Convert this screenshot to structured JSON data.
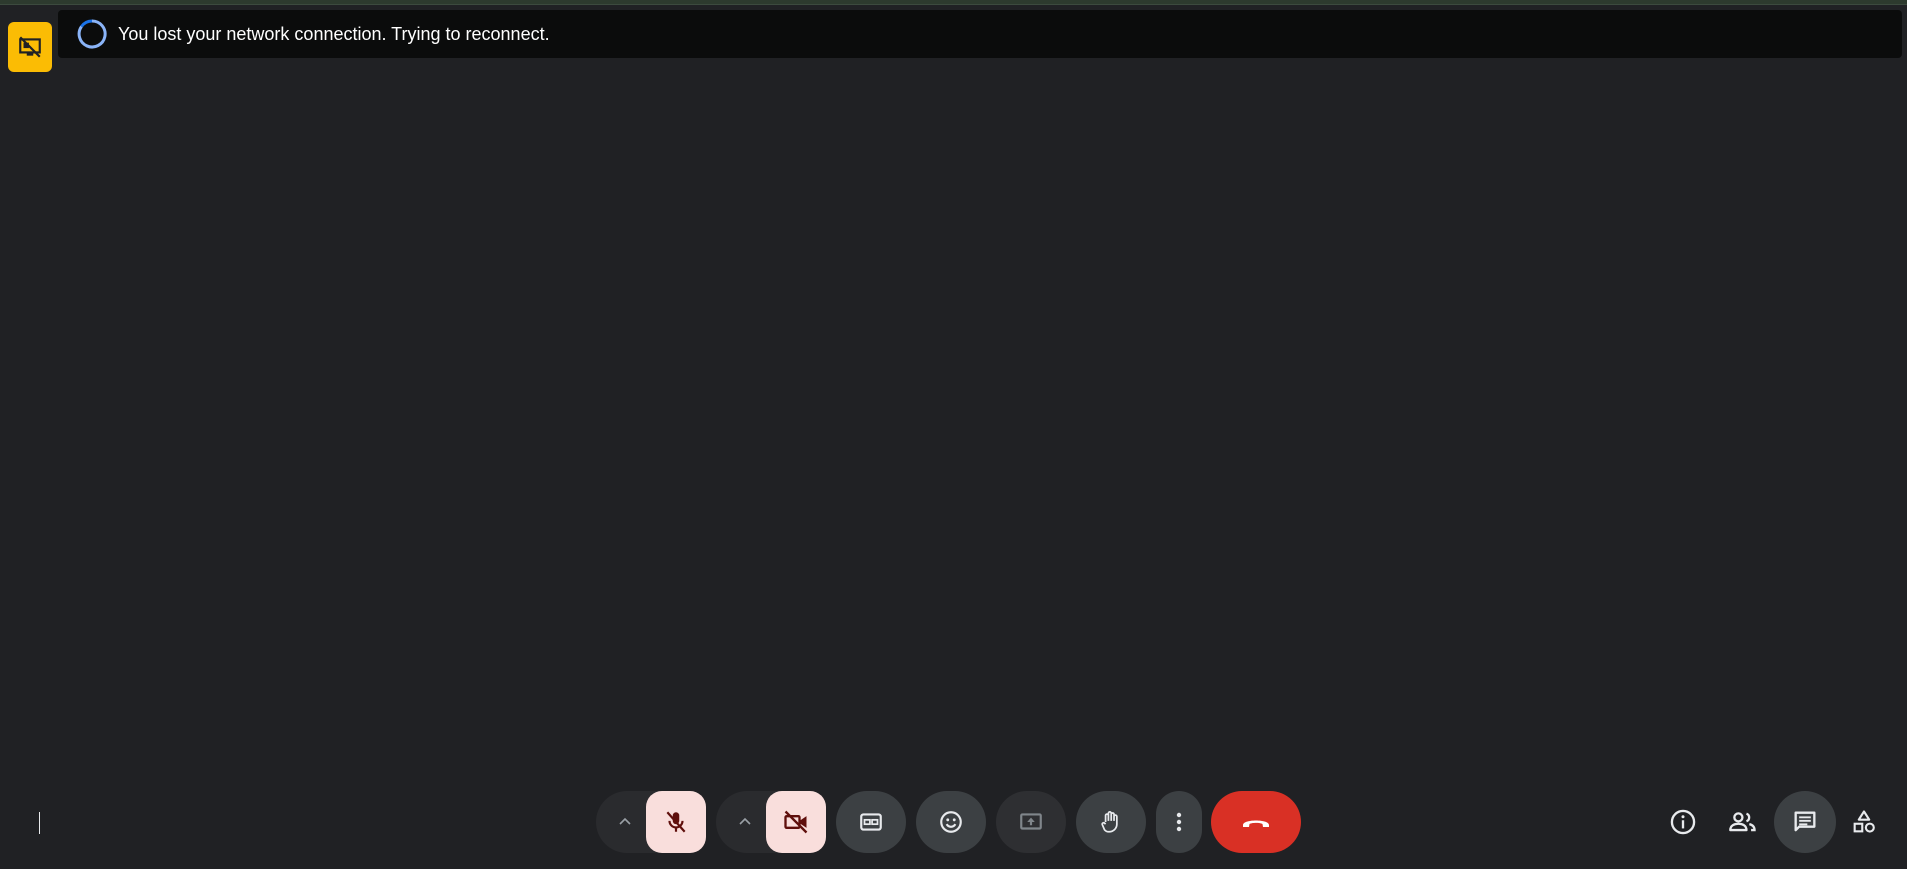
{
  "banner": {
    "message": "You lost your network connection. Trying to reconnect."
  },
  "icons": {
    "presenting_badge": "presentation-off-icon",
    "spinner": "loading-spinner-icon",
    "mic": "mic-off-icon",
    "camera": "videocam-off-icon",
    "captions": "closed-captions-icon",
    "reactions": "emoji-icon",
    "present": "present-screen-icon",
    "raise_hand": "raise-hand-icon",
    "more": "more-vert-icon",
    "leave": "call-end-icon",
    "info": "info-icon",
    "people": "people-icon",
    "chat": "chat-icon",
    "activities": "activities-icon"
  },
  "colors": {
    "background": "#202124",
    "banner": "#0b0c0c",
    "badge": "#fbbc04",
    "muted_button": "#f9dedc",
    "leave_button": "#d93025"
  }
}
